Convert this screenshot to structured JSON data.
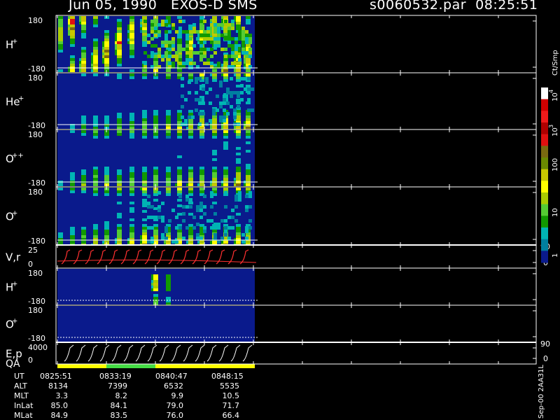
{
  "header": {
    "title": "Jun 05, 1990   EXOS-D SMS",
    "file": "s0060532.par  08:25:51"
  },
  "colorbar": {
    "unit_label": "Ct/Smp",
    "ticks": [
      "10",
      "10",
      "10",
      "100",
      "10",
      "1"
    ],
    "exponents": [
      "4",
      "3"
    ],
    "colors": [
      "#ffffff",
      "#d00000",
      "#ee1a1a",
      "#b00000",
      "#e01010",
      "#7a6a10",
      "#6a8a00",
      "#c8c800",
      "#ffff00",
      "#aacc00",
      "#55cc33",
      "#119900",
      "#00b4b4",
      "#007fa0",
      "#0a1a8c"
    ]
  },
  "panels": [
    {
      "label": "H",
      "sup": "+",
      "ytop": "180",
      "ybot": "-180",
      "tick2": ""
    },
    {
      "label": "He",
      "sup": "+",
      "ytop": "180",
      "ybot": "-180",
      "tick2": ""
    },
    {
      "label": "O",
      "sup": "++",
      "ytop": "180",
      "ybot": "-180",
      "tick2": ""
    },
    {
      "label": "O",
      "sup": "+",
      "ytop": "180",
      "ybot": "-180",
      "tick2": ""
    },
    {
      "label": "V,r",
      "sup": "",
      "ytop": "25",
      "ybot": "0",
      "tick2": "90",
      "tick2b": "0"
    },
    {
      "label": "H",
      "sup": "+",
      "ytop": "180",
      "ybot": "-180",
      "tick2": ""
    },
    {
      "label": "O",
      "sup": "+",
      "ytop": "180",
      "ybot": "-180",
      "tick2": ""
    },
    {
      "label": "E,p",
      "sup": "",
      "ytop": "4000",
      "ybot": "0",
      "tick2": "90",
      "tick2b": "0"
    }
  ],
  "qa_label": "QA",
  "qa_colors": [
    "#ffff00",
    "#44dd44"
  ],
  "ephemeris": {
    "rows": [
      {
        "name": "UT",
        "values": [
          "0825:51",
          "0833:19",
          "0840:47",
          "0848:15"
        ]
      },
      {
        "name": "ALT",
        "values": [
          "8134",
          "7399",
          "6532",
          "5535"
        ]
      },
      {
        "name": "MLT",
        "values": [
          "3.3",
          "8.2",
          "9.9",
          "10.5"
        ]
      },
      {
        "name": "InLat",
        "values": [
          "85.0",
          "84.1",
          "79.0",
          "71.7"
        ]
      },
      {
        "name": "MLat",
        "values": [
          "84.9",
          "83.5",
          "76.0",
          "66.4"
        ]
      }
    ]
  },
  "side_label": "Sep-00 2AA31L",
  "chart_data": {
    "type": "heatmap",
    "title": "Jun 05, 1990   EXOS-D SMS",
    "x_ticks": [
      "0825:51",
      "0833:19",
      "0840:47",
      "0848:15"
    ],
    "panels": [
      "H+",
      "He+",
      "O++",
      "O+",
      "V,r",
      "H+",
      "O+",
      "E,p"
    ],
    "pitch_angle_range": [
      -180,
      180
    ],
    "velocity_range": [
      0,
      25
    ],
    "energy_range": [
      0,
      4000
    ],
    "colorbar_scale": "log",
    "colorbar_range": [
      1,
      10000
    ],
    "colorbar_unit": "Ct/Smp"
  }
}
